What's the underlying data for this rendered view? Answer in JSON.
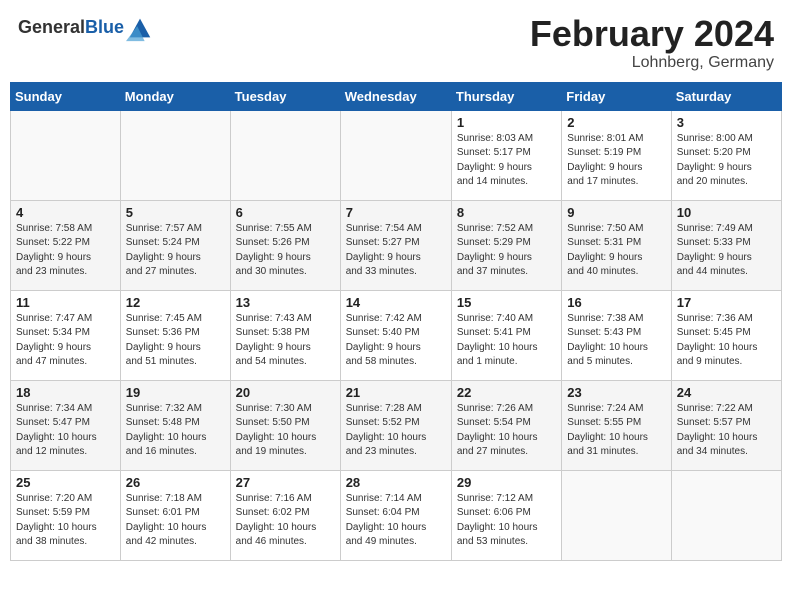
{
  "header": {
    "logo_general": "General",
    "logo_blue": "Blue",
    "title": "February 2024",
    "location": "Lohnberg, Germany"
  },
  "weekdays": [
    "Sunday",
    "Monday",
    "Tuesday",
    "Wednesday",
    "Thursday",
    "Friday",
    "Saturday"
  ],
  "weeks": [
    [
      {
        "day": "",
        "info": ""
      },
      {
        "day": "",
        "info": ""
      },
      {
        "day": "",
        "info": ""
      },
      {
        "day": "",
        "info": ""
      },
      {
        "day": "1",
        "info": "Sunrise: 8:03 AM\nSunset: 5:17 PM\nDaylight: 9 hours\nand 14 minutes."
      },
      {
        "day": "2",
        "info": "Sunrise: 8:01 AM\nSunset: 5:19 PM\nDaylight: 9 hours\nand 17 minutes."
      },
      {
        "day": "3",
        "info": "Sunrise: 8:00 AM\nSunset: 5:20 PM\nDaylight: 9 hours\nand 20 minutes."
      }
    ],
    [
      {
        "day": "4",
        "info": "Sunrise: 7:58 AM\nSunset: 5:22 PM\nDaylight: 9 hours\nand 23 minutes."
      },
      {
        "day": "5",
        "info": "Sunrise: 7:57 AM\nSunset: 5:24 PM\nDaylight: 9 hours\nand 27 minutes."
      },
      {
        "day": "6",
        "info": "Sunrise: 7:55 AM\nSunset: 5:26 PM\nDaylight: 9 hours\nand 30 minutes."
      },
      {
        "day": "7",
        "info": "Sunrise: 7:54 AM\nSunset: 5:27 PM\nDaylight: 9 hours\nand 33 minutes."
      },
      {
        "day": "8",
        "info": "Sunrise: 7:52 AM\nSunset: 5:29 PM\nDaylight: 9 hours\nand 37 minutes."
      },
      {
        "day": "9",
        "info": "Sunrise: 7:50 AM\nSunset: 5:31 PM\nDaylight: 9 hours\nand 40 minutes."
      },
      {
        "day": "10",
        "info": "Sunrise: 7:49 AM\nSunset: 5:33 PM\nDaylight: 9 hours\nand 44 minutes."
      }
    ],
    [
      {
        "day": "11",
        "info": "Sunrise: 7:47 AM\nSunset: 5:34 PM\nDaylight: 9 hours\nand 47 minutes."
      },
      {
        "day": "12",
        "info": "Sunrise: 7:45 AM\nSunset: 5:36 PM\nDaylight: 9 hours\nand 51 minutes."
      },
      {
        "day": "13",
        "info": "Sunrise: 7:43 AM\nSunset: 5:38 PM\nDaylight: 9 hours\nand 54 minutes."
      },
      {
        "day": "14",
        "info": "Sunrise: 7:42 AM\nSunset: 5:40 PM\nDaylight: 9 hours\nand 58 minutes."
      },
      {
        "day": "15",
        "info": "Sunrise: 7:40 AM\nSunset: 5:41 PM\nDaylight: 10 hours\nand 1 minute."
      },
      {
        "day": "16",
        "info": "Sunrise: 7:38 AM\nSunset: 5:43 PM\nDaylight: 10 hours\nand 5 minutes."
      },
      {
        "day": "17",
        "info": "Sunrise: 7:36 AM\nSunset: 5:45 PM\nDaylight: 10 hours\nand 9 minutes."
      }
    ],
    [
      {
        "day": "18",
        "info": "Sunrise: 7:34 AM\nSunset: 5:47 PM\nDaylight: 10 hours\nand 12 minutes."
      },
      {
        "day": "19",
        "info": "Sunrise: 7:32 AM\nSunset: 5:48 PM\nDaylight: 10 hours\nand 16 minutes."
      },
      {
        "day": "20",
        "info": "Sunrise: 7:30 AM\nSunset: 5:50 PM\nDaylight: 10 hours\nand 19 minutes."
      },
      {
        "day": "21",
        "info": "Sunrise: 7:28 AM\nSunset: 5:52 PM\nDaylight: 10 hours\nand 23 minutes."
      },
      {
        "day": "22",
        "info": "Sunrise: 7:26 AM\nSunset: 5:54 PM\nDaylight: 10 hours\nand 27 minutes."
      },
      {
        "day": "23",
        "info": "Sunrise: 7:24 AM\nSunset: 5:55 PM\nDaylight: 10 hours\nand 31 minutes."
      },
      {
        "day": "24",
        "info": "Sunrise: 7:22 AM\nSunset: 5:57 PM\nDaylight: 10 hours\nand 34 minutes."
      }
    ],
    [
      {
        "day": "25",
        "info": "Sunrise: 7:20 AM\nSunset: 5:59 PM\nDaylight: 10 hours\nand 38 minutes."
      },
      {
        "day": "26",
        "info": "Sunrise: 7:18 AM\nSunset: 6:01 PM\nDaylight: 10 hours\nand 42 minutes."
      },
      {
        "day": "27",
        "info": "Sunrise: 7:16 AM\nSunset: 6:02 PM\nDaylight: 10 hours\nand 46 minutes."
      },
      {
        "day": "28",
        "info": "Sunrise: 7:14 AM\nSunset: 6:04 PM\nDaylight: 10 hours\nand 49 minutes."
      },
      {
        "day": "29",
        "info": "Sunrise: 7:12 AM\nSunset: 6:06 PM\nDaylight: 10 hours\nand 53 minutes."
      },
      {
        "day": "",
        "info": ""
      },
      {
        "day": "",
        "info": ""
      }
    ]
  ]
}
